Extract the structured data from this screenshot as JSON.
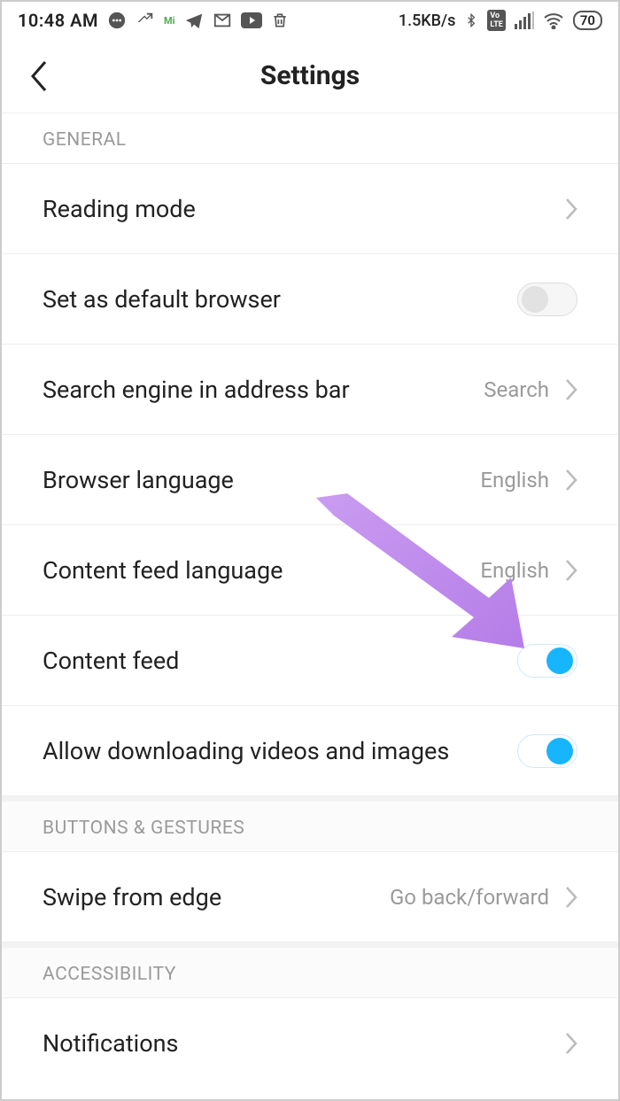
{
  "status": {
    "time": "10:48 AM",
    "data_rate": "1.5KB/s",
    "battery": "70"
  },
  "header": {
    "title": "Settings"
  },
  "sections": {
    "general": {
      "label": "GENERAL",
      "reading_mode": "Reading mode",
      "default_browser": "Set as default browser",
      "search_engine": "Search engine in address bar",
      "search_engine_value": "Search",
      "browser_language": "Browser language",
      "browser_language_value": "English",
      "content_feed_language": "Content feed language",
      "content_feed_language_value": "English",
      "content_feed": "Content feed",
      "allow_download": "Allow downloading videos and images"
    },
    "buttons_gestures": {
      "label": "BUTTONS & GESTURES",
      "swipe": "Swipe from edge",
      "swipe_value": "Go back/forward"
    },
    "accessibility": {
      "label": "ACCESSIBILITY",
      "notifications": "Notifications"
    }
  }
}
